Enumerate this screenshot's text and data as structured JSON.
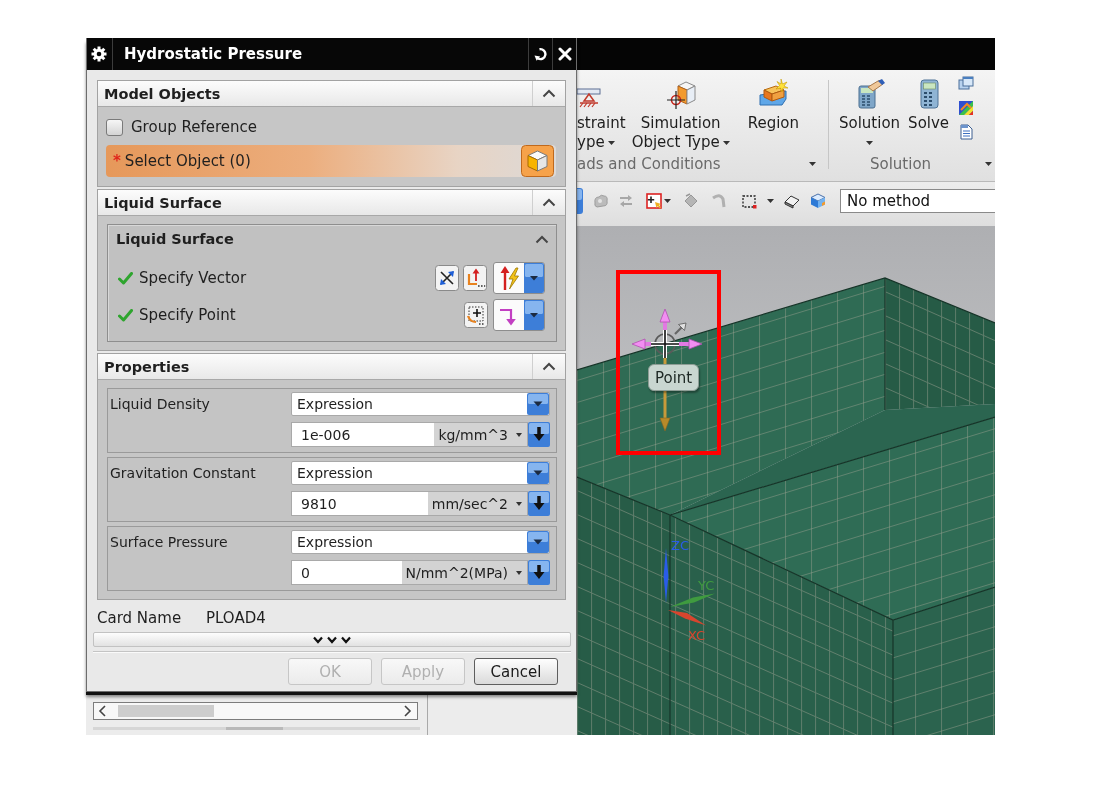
{
  "dialog": {
    "title": "Hydrostatic Pressure",
    "sections": [
      {
        "kind": "model_objects",
        "title": "Model Objects",
        "expanded": true,
        "group_reference": {
          "label": "Group Reference",
          "checked": false
        },
        "selection": {
          "required_mark": "*",
          "label": "Select Object (0)",
          "active": true
        }
      },
      {
        "kind": "liquid_surface",
        "title": "Liquid Surface",
        "expanded": true,
        "group": {
          "title": "Liquid Surface",
          "expanded": true,
          "rows": [
            {
              "kind": "vector",
              "label": "Specify Vector",
              "done": true
            },
            {
              "kind": "point",
              "label": "Specify Point",
              "done": true
            }
          ]
        }
      },
      {
        "kind": "properties",
        "title": "Properties",
        "expanded": true,
        "fields": [
          {
            "label": "Liquid Density",
            "mode": "Expression",
            "value": "1e-006",
            "unit": "kg/mm^3"
          },
          {
            "label": "Gravitation Constant",
            "mode": "Expression",
            "value": "9810",
            "unit": "mm/sec^2"
          },
          {
            "label": "Surface Pressure",
            "mode": "Expression",
            "value": "0",
            "unit": "N/mm^2(MPa)"
          }
        ]
      }
    ],
    "card_name": {
      "label": "Card Name",
      "value": "PLOAD4"
    },
    "buttons": [
      {
        "label": "OK",
        "disabled": true
      },
      {
        "label": "Apply",
        "disabled": true
      },
      {
        "label": "Cancel",
        "disabled": false
      }
    ]
  },
  "ribbon": {
    "groups": [
      {
        "label": "ads and Conditions",
        "items": [
          {
            "lines": [
              "straint",
              "ype"
            ],
            "dropdown": true
          },
          {
            "lines": [
              "Simulation",
              "Object Type"
            ],
            "dropdown": true
          },
          {
            "lines": [
              "Region"
            ],
            "dropdown": false
          }
        ]
      },
      {
        "label": "Solution",
        "items": [
          {
            "lines": [
              "Solution"
            ],
            "dropdown": true
          },
          {
            "lines": [
              "Solve"
            ],
            "dropdown": false
          }
        ]
      }
    ]
  },
  "toolbar": {
    "tools": [
      {
        "disabled": true,
        "dropdown": false
      },
      {
        "disabled": true,
        "dropdown": false
      },
      {
        "disabled": false,
        "dropdown": true
      },
      {
        "disabled": true,
        "dropdown": false
      },
      {
        "disabled": true,
        "dropdown": false
      },
      {
        "disabled": false,
        "dropdown": true
      },
      {
        "disabled": false,
        "dropdown": false
      },
      {
        "disabled": false,
        "dropdown": false
      }
    ],
    "method_field": {
      "value": "No method"
    }
  },
  "viewport": {
    "tooltip": "Point",
    "axes": [
      {
        "label": "ZC",
        "color": "#2a5ce8"
      },
      {
        "label": "YC",
        "color": "#3f9b3f"
      },
      {
        "label": "XC",
        "color": "#d8452e"
      }
    ]
  }
}
